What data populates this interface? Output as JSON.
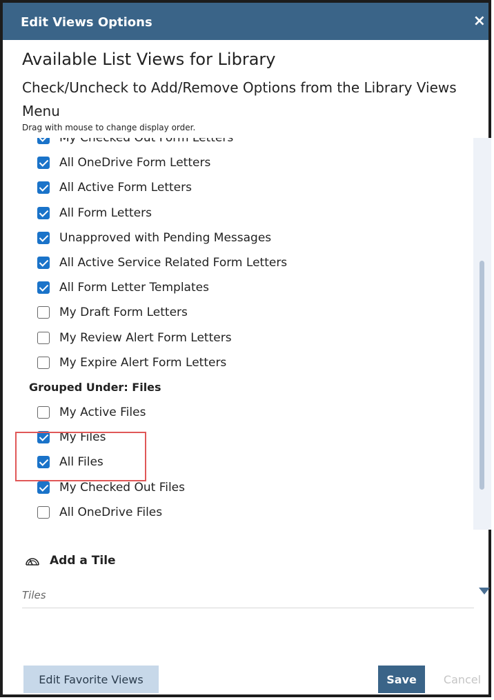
{
  "dialog": {
    "title": "Edit Views Options",
    "close_label": "×",
    "heading": "Available List Views for Library",
    "subheading": "Check/Uncheck to Add/Remove Options from the Library Views Menu",
    "hint": "Drag with mouse to change display order."
  },
  "list": {
    "items": [
      {
        "label": "My Checked Out Form Letters",
        "checked": true
      },
      {
        "label": "All OneDrive Form Letters",
        "checked": true
      },
      {
        "label": "All Active Form Letters",
        "checked": true
      },
      {
        "label": "All Form Letters",
        "checked": true
      },
      {
        "label": "Unapproved with Pending Messages",
        "checked": true
      },
      {
        "label": "All Active Service Related Form Letters",
        "checked": true
      },
      {
        "label": "All Form Letter Templates",
        "checked": true
      },
      {
        "label": "My Draft Form Letters",
        "checked": false
      },
      {
        "label": "My Review Alert Form Letters",
        "checked": false
      },
      {
        "label": "My Expire Alert Form Letters",
        "checked": false
      }
    ],
    "group_header": "Grouped Under: Files",
    "group_items": [
      {
        "label": "My Active Files",
        "checked": false
      },
      {
        "label": "My Files",
        "checked": true
      },
      {
        "label": "All Files",
        "checked": true
      },
      {
        "label": "My Checked Out Files",
        "checked": true
      },
      {
        "label": "All OneDrive Files",
        "checked": false
      }
    ]
  },
  "tile": {
    "icon": "gauge-icon",
    "label": "Add a Tile",
    "placeholder": "Tiles"
  },
  "buttons": {
    "edit_favorites": "Edit Favorite Views",
    "save": "Save",
    "cancel": "Cancel"
  },
  "colors": {
    "header_bg": "#3a6488",
    "checkbox_checked": "#1a73c9",
    "highlight_box": "#e05757",
    "favorites_bg": "#c7d8e9"
  }
}
